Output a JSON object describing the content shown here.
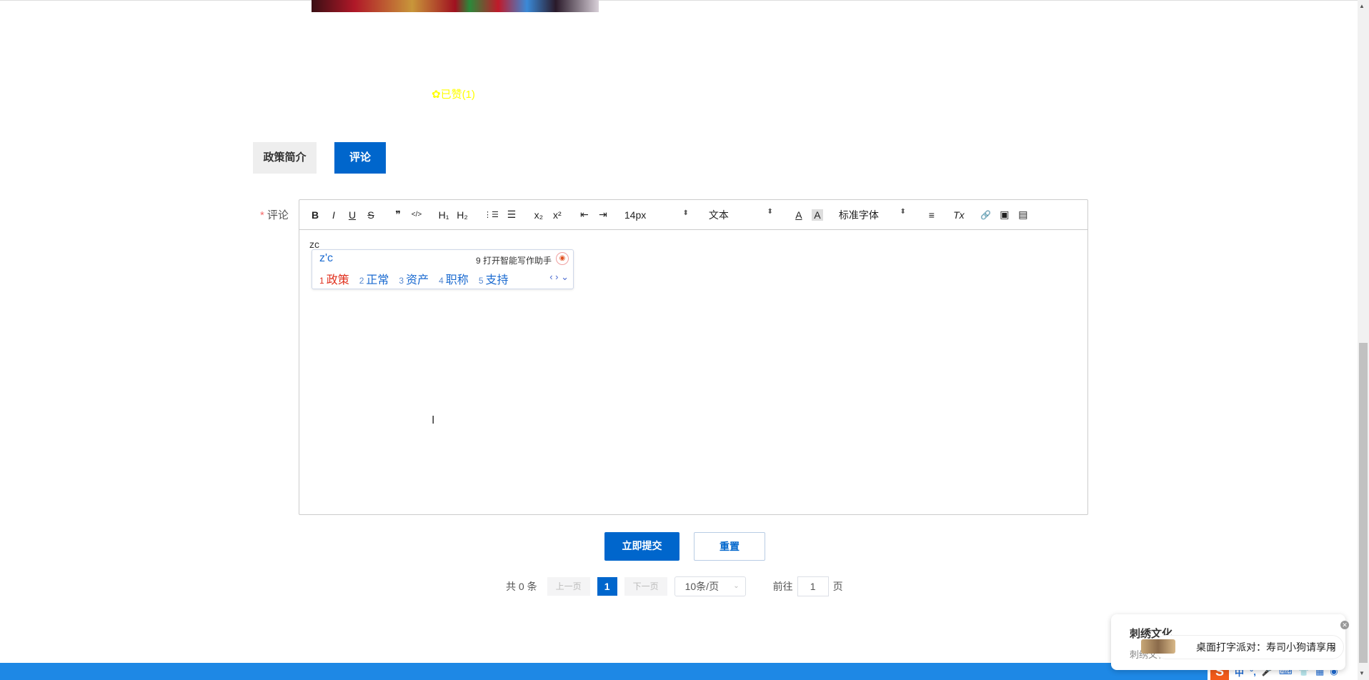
{
  "like": {
    "label": "已赞(1)"
  },
  "tabs": [
    {
      "label": "政策简介"
    },
    {
      "label": "评论"
    }
  ],
  "form": {
    "required_mark": "*",
    "comment_label": "评论",
    "content": "zc"
  },
  "toolbar": {
    "bold": "B",
    "italic": "I",
    "underline": "U",
    "strike": "S",
    "quote": "❞",
    "code": "</>",
    "h1": "H₁",
    "h2": "H₂",
    "ol": "⋮☰",
    "ul": "☰",
    "sub": "x₂",
    "sup": "x²",
    "outdent": "⇤",
    "indent": "⇥",
    "font_size": "14px",
    "block_type": "文本",
    "font_color": "A",
    "bg_color": "A",
    "font_family": "标准字体",
    "align": "≡",
    "clear": "Tx",
    "link": "🔗",
    "image": "▣",
    "video": "▤"
  },
  "ime": {
    "input": "z'c",
    "hint": "9 打开智能写作助手",
    "candidates": [
      {
        "n": "1",
        "text": "政策"
      },
      {
        "n": "2",
        "text": "正常"
      },
      {
        "n": "3",
        "text": "资产"
      },
      {
        "n": "4",
        "text": "职称"
      },
      {
        "n": "5",
        "text": "支持"
      }
    ],
    "nav": "‹ › ⌄"
  },
  "buttons": {
    "submit": "立即提交",
    "reset": "重置"
  },
  "pagination": {
    "total": "共 0 条",
    "prev": "上一页",
    "current": "1",
    "next": "下一页",
    "page_size": "10条/页",
    "goto_prefix": "前往",
    "goto_value": "1",
    "goto_suffix": "页"
  },
  "notification": {
    "title": "刺绣文化",
    "body": "刺绣文化刺绣文化刺绣文化",
    "banner": "桌面打字派对：寿司小狗请享用",
    "arrow": "›"
  },
  "ime_bar": {
    "logo": "S",
    "mode": "中",
    "punct": "°,",
    "mic": "🎤",
    "keyboard": "⌨",
    "skin": "👕",
    "apps": "▦",
    "assistant": "◉"
  },
  "colors": {
    "primary": "#0066cc",
    "liked": "#ffff00",
    "taskbar": "#1e88e5"
  }
}
